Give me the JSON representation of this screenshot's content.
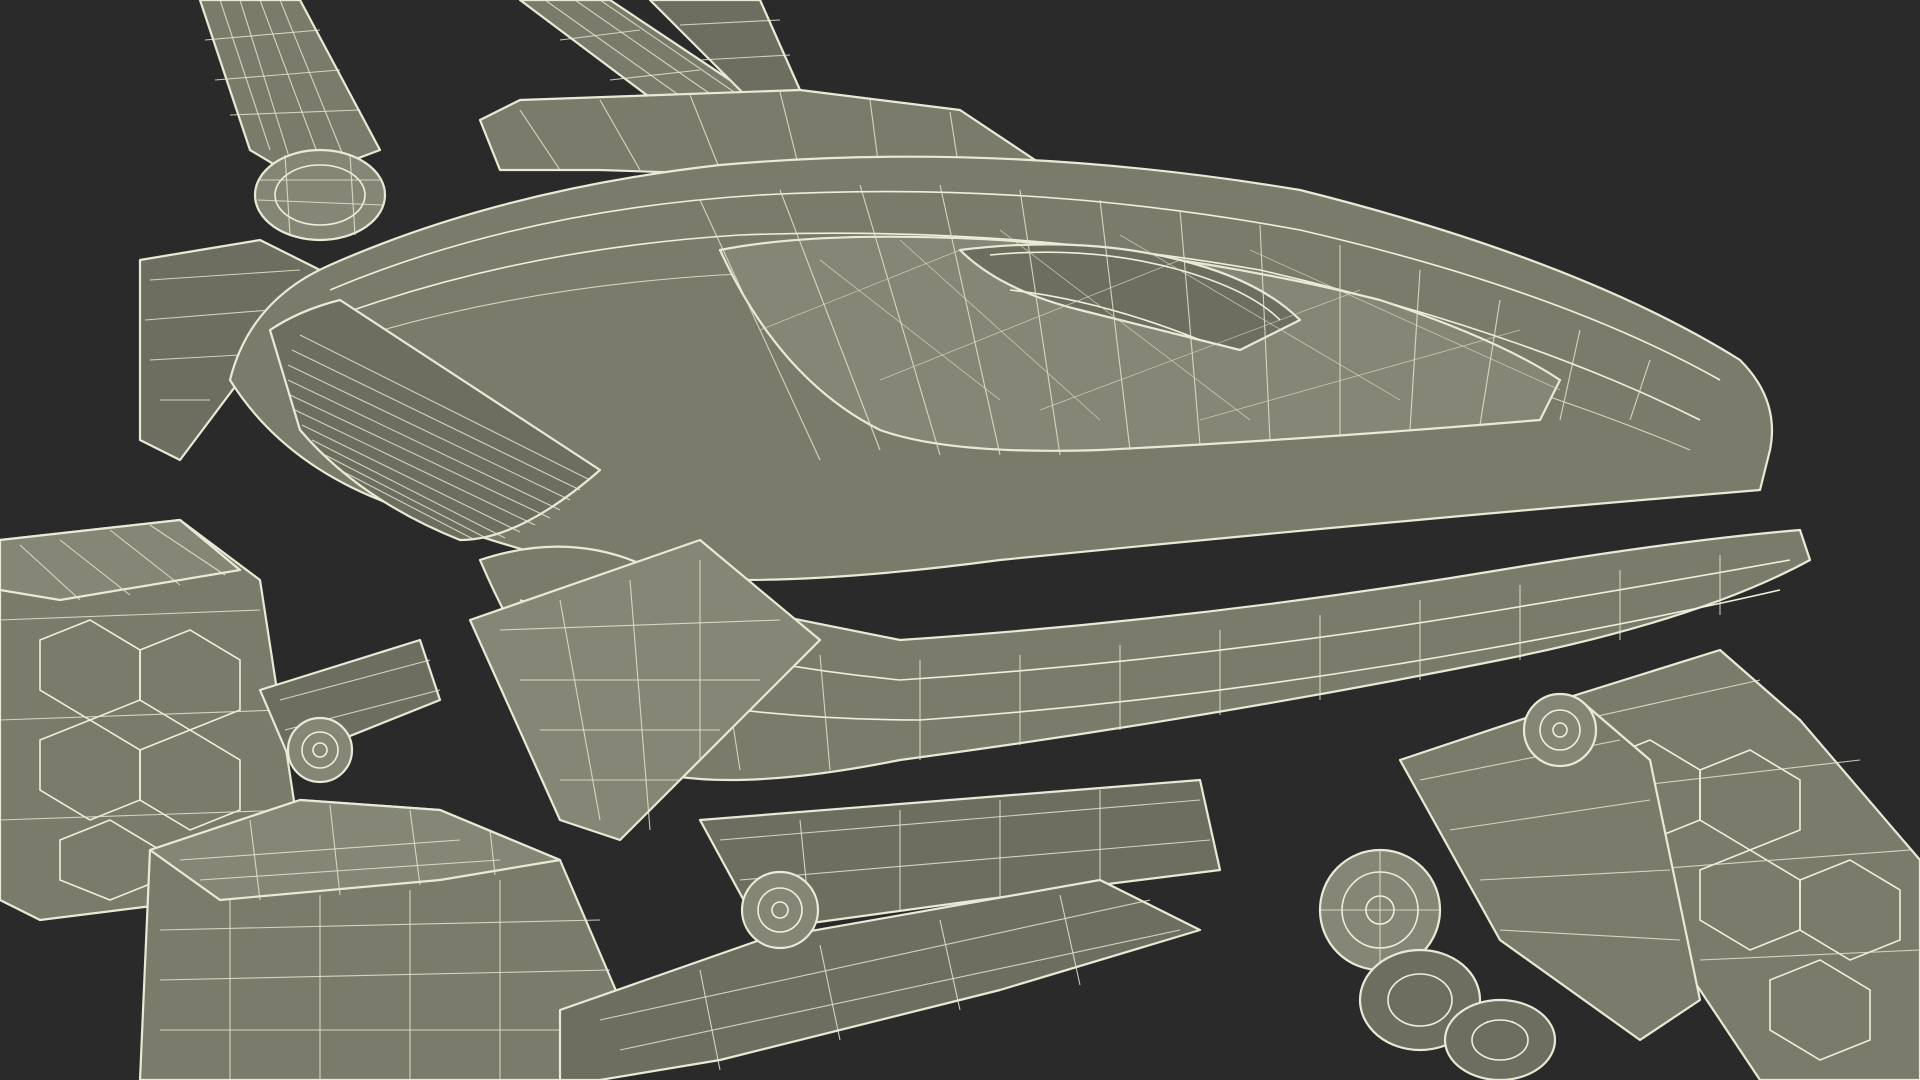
{
  "scene": {
    "subject": "wireframe-render",
    "background_color": "#2a2a2a",
    "surface_color": "#7a7b6b",
    "wire_color": "#e9ead6"
  }
}
